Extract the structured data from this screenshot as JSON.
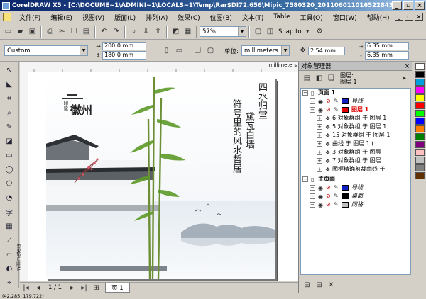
{
  "titlebar": {
    "title": "CorelDRAW X5 - [C:\\DOCUME~1\\ADMINI~1\\LOCALS~1\\Temp\\Rar$DI72.656\\Mipic_7580320_20110601101652284312.cdr]"
  },
  "menu": {
    "items": [
      "文件(F)",
      "编辑(E)",
      "视图(V)",
      "版面(L)",
      "排列(A)",
      "效果(C)",
      "位图(B)",
      "文本(T)",
      "Table",
      "工具(O)",
      "窗口(W)",
      "帮助(H)"
    ]
  },
  "toolbar1": {
    "zoom": "57%",
    "snap": "Snap to"
  },
  "propbar": {
    "paper": "Custom",
    "width": "200.0 mm",
    "height": "180.0 mm",
    "units_label": "单位:",
    "units": "millimeters",
    "nudge": "2.54 mm",
    "dup_x": "6.35 mm",
    "dup_y": "6.35 mm"
  },
  "ruler": {
    "unit": "millimeters",
    "vunit": "millimeters"
  },
  "artwork": {
    "logo_small": "印象",
    "logo_big": "徽州",
    "poem_col1": "四水归堂",
    "poem_col2": "黛瓦白墙",
    "poem_col3": "符号里的风水哲居"
  },
  "status": {
    "page_counter": "1 / 1",
    "page_tab": "页 1"
  },
  "coords": "(42.285, 179.722)",
  "panel": {
    "title": "对象管理器",
    "current_layer_label": "图层:",
    "current_layer": "图层 1",
    "tree": [
      {
        "kind": "page",
        "text": "页面 1",
        "indent": 0
      },
      {
        "kind": "layer",
        "text": "导线",
        "indent": 1,
        "color": "#1020c0"
      },
      {
        "kind": "layer",
        "text": "图层 1",
        "indent": 1,
        "color": "#e00000",
        "selected": true
      },
      {
        "kind": "obj",
        "text": "6 对象群组 于 图层 1",
        "indent": 2
      },
      {
        "kind": "obj",
        "text": "5 对象群组 于 图层 1",
        "indent": 2
      },
      {
        "kind": "obj",
        "text": "15 对象群组 于 图层 1",
        "indent": 2
      },
      {
        "kind": "obj",
        "text": "曲线 于 图层 1 (",
        "indent": 2
      },
      {
        "kind": "obj",
        "text": "3 对象群组 于 图层",
        "indent": 2
      },
      {
        "kind": "obj",
        "text": "7 对象群组 于 图层",
        "indent": 2
      },
      {
        "kind": "obj",
        "text": "图框精确剪裁曲线 于",
        "indent": 2
      },
      {
        "kind": "page",
        "text": "主页面",
        "indent": 0
      },
      {
        "kind": "layer",
        "text": "导线",
        "indent": 1,
        "color": "#1020c0"
      },
      {
        "kind": "layer",
        "text": "桌面",
        "indent": 1,
        "color": "#000000"
      },
      {
        "kind": "layer",
        "text": "网格",
        "indent": 1,
        "color": "#c0c0c0"
      }
    ]
  },
  "colors": {
    "titlebar": "#0a246a",
    "accent_red": "#e00000",
    "palette": [
      "#ffffff",
      "#000000",
      "#00a0e0",
      "#ff00ff",
      "#ffff00",
      "#ff0000",
      "#00ff00",
      "#0000ff",
      "#ff8000",
      "#008000",
      "#800080",
      "#ffc0c0",
      "#c0c0c0",
      "#808080",
      "#603000"
    ]
  }
}
